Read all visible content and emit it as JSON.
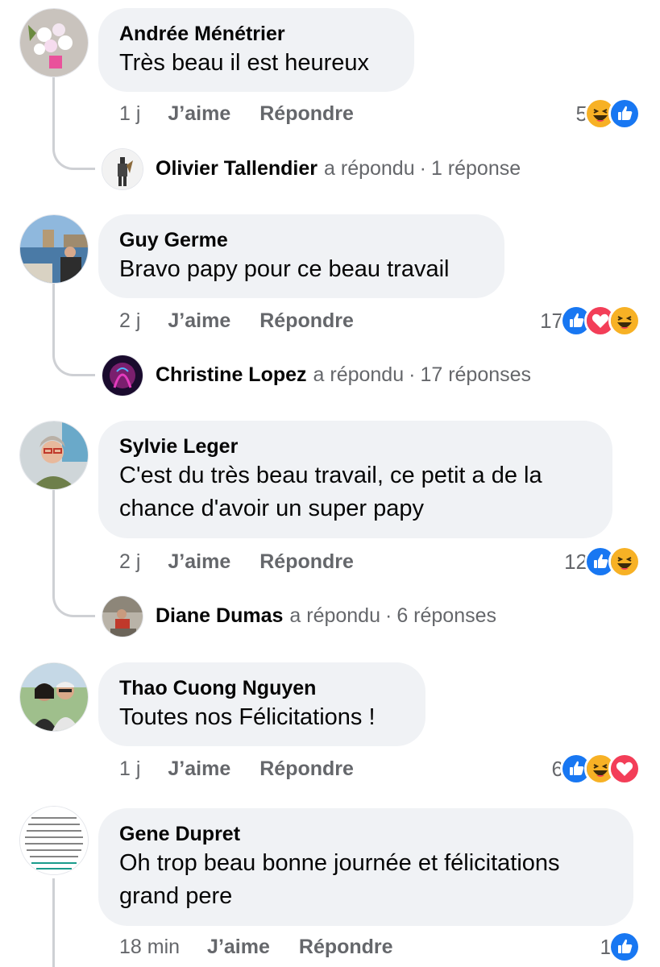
{
  "comments": [
    {
      "author": "Andrée Ménétrier",
      "text_lines": [
        "Très beau il est heureux"
      ],
      "time": "1 j",
      "like_label": "J’aime",
      "reply_label": "Répondre",
      "reaction_count": "5",
      "reactions": [
        "haha",
        "like"
      ],
      "reply_summary": {
        "name": "Olivier Tallendier",
        "verb": "a répondu",
        "dot": "·",
        "count": "1 réponse"
      }
    },
    {
      "author": "Guy Germe",
      "text_lines": [
        "Bravo papy pour ce beau travail"
      ],
      "time": "2 j",
      "like_label": "J’aime",
      "reply_label": "Répondre",
      "reaction_count": "17",
      "reactions": [
        "like",
        "love",
        "haha"
      ],
      "reply_summary": {
        "name": "Christine Lopez",
        "verb": "a répondu",
        "dot": "·",
        "count": "17 réponses"
      }
    },
    {
      "author": "Sylvie Leger",
      "text_lines": [
        "C'est du très beau travail, ce petit a de la",
        "chance d'avoir un super papy"
      ],
      "time": "2 j",
      "like_label": "J’aime",
      "reply_label": "Répondre",
      "reaction_count": "12",
      "reactions": [
        "like",
        "haha"
      ],
      "reply_summary": {
        "name": "Diane Dumas",
        "verb": "a répondu",
        "dot": "·",
        "count": "6 réponses"
      }
    },
    {
      "author": "Thao Cuong Nguyen",
      "text_lines": [
        "Toutes nos Félicitations !"
      ],
      "time": "1 j",
      "like_label": "J’aime",
      "reply_label": "Répondre",
      "reaction_count": "6",
      "reactions": [
        "like",
        "haha",
        "love"
      ]
    },
    {
      "author": "Gene Dupret",
      "text_lines": [
        "Oh trop beau bonne journée et félicitations",
        "grand pere"
      ],
      "time": "18 min",
      "like_label": "J’aime",
      "reply_label": "Répondre",
      "reaction_count": "1",
      "reactions": [
        "like"
      ]
    }
  ],
  "colors": {
    "like_blue": "#1877f2",
    "love_red": "#f33e58",
    "haha_yellow": "#f7b125",
    "bubble_bg": "#f0f2f5",
    "meta_gray": "#65676b"
  }
}
